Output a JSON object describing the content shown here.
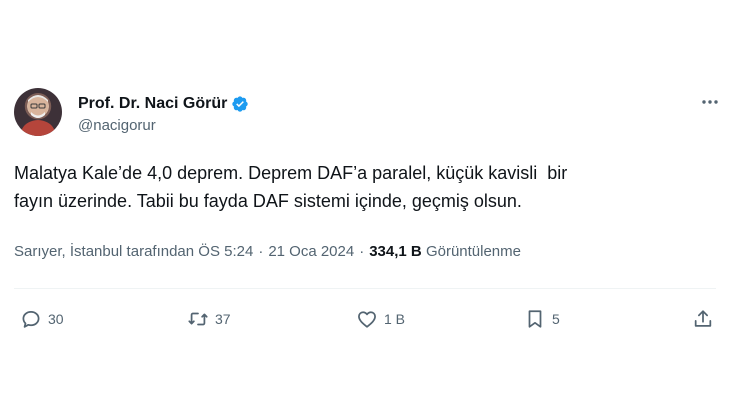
{
  "author": {
    "display_name": "Prof. Dr. Naci Görür",
    "handle": "@nacigorur",
    "verified": true
  },
  "tweet": {
    "lines": [
      "Malatya Kale’de 4,0 deprem. Deprem DAF’a paralel, küçük kavisli  bir",
      "fayın üzerinde. Tabii bu fayda DAF sistemi içinde, geçmiş olsun."
    ]
  },
  "meta": {
    "location_time": "Sarıyer, İstanbul tarafından ÖS 5:24",
    "separator": "·",
    "date": "21 Oca 2024",
    "views_count": "334,1 B",
    "views_label": "Görüntülenme"
  },
  "actions": {
    "replies": "30",
    "retweets": "37",
    "likes": "1 B",
    "bookmarks": "5"
  },
  "colors": {
    "verified": "#1d9bf0",
    "secondary_text": "#536471",
    "primary_text": "#0f1419",
    "divider": "#eff3f4"
  }
}
